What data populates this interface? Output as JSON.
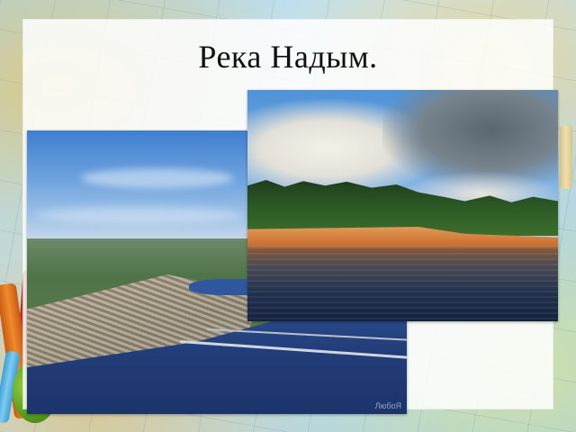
{
  "slide": {
    "title": "Река Надым."
  },
  "photos": {
    "aerial": {
      "watermark": "ЛюбоЯ"
    },
    "river": {}
  },
  "colors": {
    "frame": "#b6d9e8",
    "panel": "#ffffff",
    "title_text": "#111111"
  },
  "icons": [
    "pencil-icon",
    "map-frame"
  ]
}
